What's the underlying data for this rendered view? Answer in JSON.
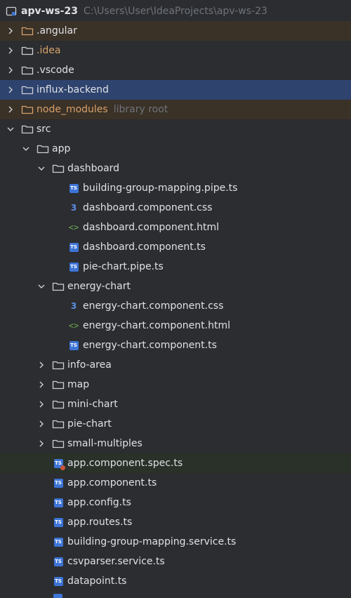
{
  "project": {
    "name": "apv-ws-23",
    "path": "C:\\Users\\User\\IdeaProjects\\apv-ws-23"
  },
  "tree": {
    "angular": ".angular",
    "idea": ".idea",
    "vscode": ".vscode",
    "influx_backend": "influx-backend",
    "node_modules": "node_modules",
    "node_modules_hint": "library root",
    "src": "src",
    "app": "app",
    "dashboard": {
      "folder": "dashboard",
      "files": [
        "building-group-mapping.pipe.ts",
        "dashboard.component.css",
        "dashboard.component.html",
        "dashboard.component.ts",
        "pie-chart.pipe.ts"
      ]
    },
    "energy_chart": {
      "folder": "energy-chart",
      "files": [
        "energy-chart.component.css",
        "energy-chart.component.html",
        "energy-chart.component.ts"
      ]
    },
    "folders": [
      "info-area",
      "map",
      "mini-chart",
      "pie-chart",
      "small-multiples"
    ],
    "app_files": [
      "app.component.spec.ts",
      "app.component.ts",
      "app.config.ts",
      "app.routes.ts",
      "building-group-mapping.service.ts",
      "csvparser.service.ts",
      "datapoint.ts"
    ]
  },
  "icons": {
    "ts_badge": "TS",
    "css_badge": "3",
    "html_badge": "<>"
  },
  "colors": {
    "background": "#2b2d30",
    "selected": "#2e436e",
    "ignored_row": "#3a3127",
    "changed_row": "#293128",
    "ignored_text": "#d7a06b",
    "ts_icon": "#3d74d6",
    "html_icon": "#6ea956"
  }
}
